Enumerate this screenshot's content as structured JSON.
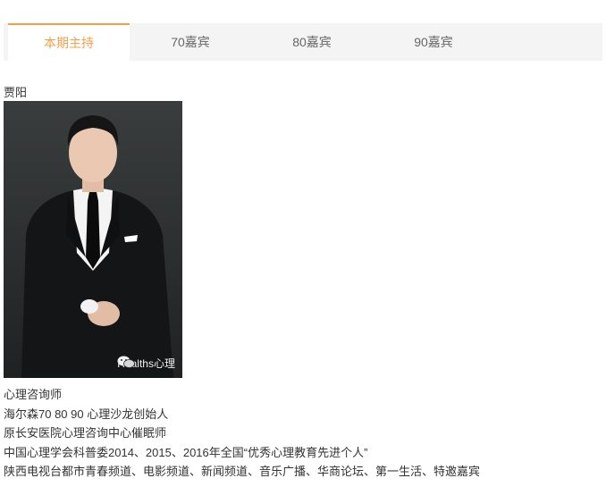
{
  "tabs": [
    {
      "label": "本期主持",
      "active": true
    },
    {
      "label": "70嘉宾",
      "active": false
    },
    {
      "label": "80嘉宾",
      "active": false
    },
    {
      "label": "90嘉宾",
      "active": false
    }
  ],
  "host": {
    "name": "贾阳",
    "photo": {
      "icon": "wechat-icon",
      "watermark": "Healths心理"
    },
    "bio": [
      "心理咨询师",
      "海尔森70 80 90 心理沙龙创始人",
      "原长安医院心理咨询中心催眠师",
      "中国心理学会科普委2014、2015、2016年全国“优秀心理教育先进个人”",
      "陕西电视台都市青春频道、电影频道、新闻频道、音乐广播、华商论坛、第一生活、特邀嘉宾"
    ]
  },
  "colors": {
    "accent": "#f0a04b",
    "tab_bar": "#f4f4f4"
  }
}
